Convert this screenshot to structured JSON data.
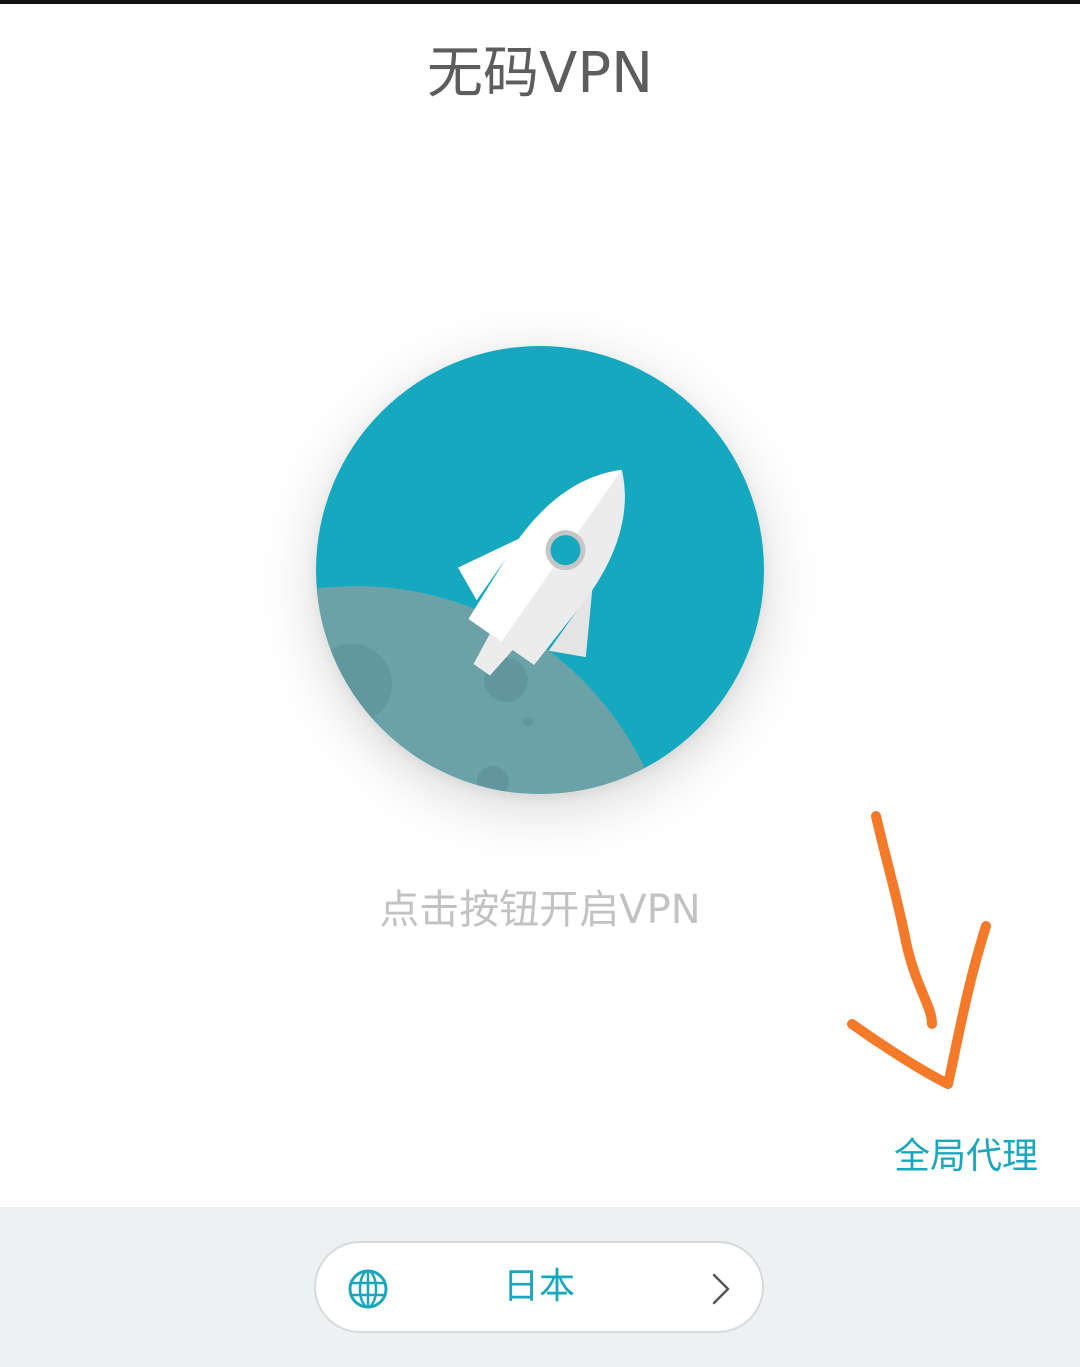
{
  "header": {
    "title": "无码VPN"
  },
  "main": {
    "connect_button_icon": "rocket-icon",
    "hint": "点击按钮开启VPN",
    "proxy_mode": "全局代理"
  },
  "server": {
    "icon": "globe-icon",
    "name": "日本",
    "chevron": "chevron-right-icon"
  },
  "colors": {
    "accent": "#15a8be",
    "moon": "#6aa2a8",
    "annotation": "#f47a2a"
  }
}
